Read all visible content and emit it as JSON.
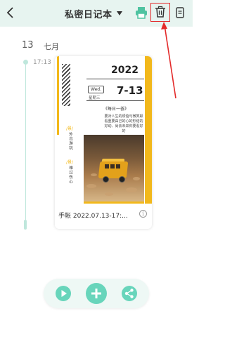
{
  "header": {
    "title": "私密日记本",
    "icons": {
      "back": "chevron-left-icon",
      "print": "printer-icon",
      "delete": "trash-icon",
      "menu": "document-icon"
    },
    "colors": {
      "bar_bg": "#e7f4f0",
      "accent": "#4fc3a1",
      "highlight": "#e32a2a"
    }
  },
  "date_header": {
    "day": "13",
    "month": "七月"
  },
  "entry": {
    "time": "17:13",
    "caption": "手帐 2022.07.13-17:...",
    "cover": {
      "year": "2022",
      "weekday_en": "Wed.",
      "weekday_cn": "星期三",
      "month_day": "7-13",
      "daily_title": "《每日一荟》",
      "daily_text": "要对人生的烦恼与微笑颠看重要由己的心的形结的好动、尚去未来你要看好的",
      "side_label_top": "外出游玩",
      "side_label_bottom": "难过伤心",
      "side_mark_top": "/景/",
      "side_mark_bottom": "/景/"
    }
  },
  "bottom_bar": {
    "icons": {
      "play": "play-icon",
      "add": "plus-icon",
      "share": "share-icon"
    },
    "color": "#68d5bb"
  }
}
